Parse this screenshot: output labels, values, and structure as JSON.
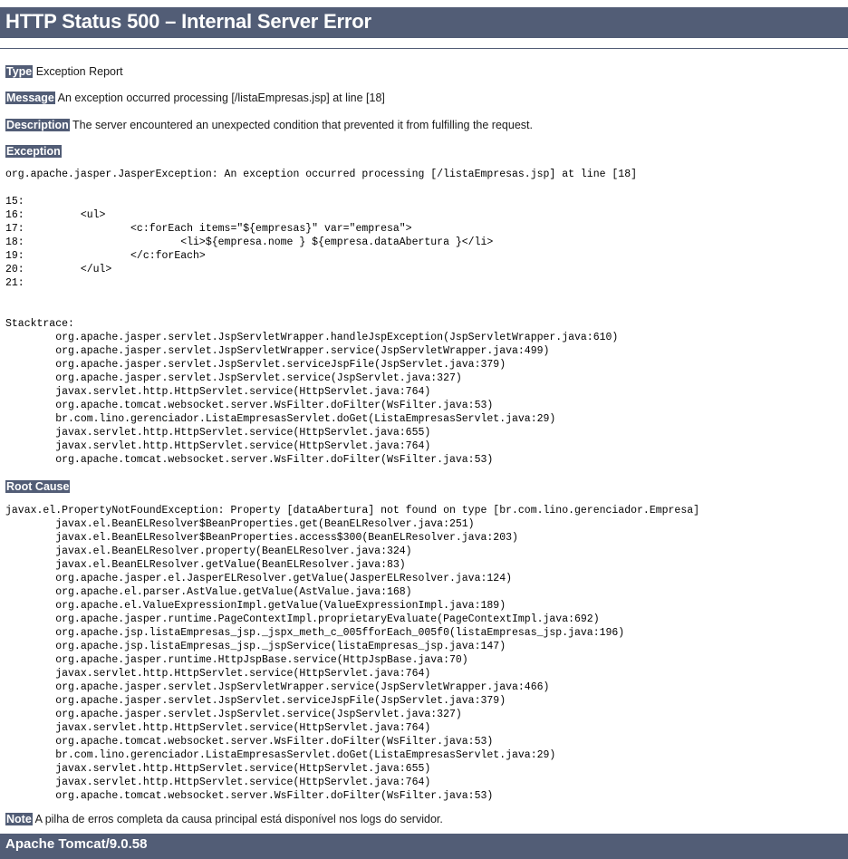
{
  "header": {
    "title": "HTTP Status 500 – Internal Server Error",
    "bar_color": "#525D76",
    "text_color": "#FFFFFF"
  },
  "details": {
    "type_label": "Type",
    "type_value": "Exception Report",
    "message_label": "Message",
    "message_value": "An exception occurred processing [/listaEmpresas.jsp] at line [18]",
    "description_label": "Description",
    "description_value": "The server encountered an unexpected condition that prevented it from fulfilling the request."
  },
  "exception_section": {
    "heading": "Exception",
    "body": "org.apache.jasper.JasperException: An exception occurred processing [/listaEmpresas.jsp] at line [18]\n\n15: \n16:         <ul>\n17:                 <c:forEach items=\"${empresas}\" var=\"empresa\">\n18:                         <li>${empresa.nome } ${empresa.dataAbertura }</li>\n19:                 </c:forEach>\n20:         </ul>\n21: \n\n\nStacktrace:\n        org.apache.jasper.servlet.JspServletWrapper.handleJspException(JspServletWrapper.java:610)\n        org.apache.jasper.servlet.JspServletWrapper.service(JspServletWrapper.java:499)\n        org.apache.jasper.servlet.JspServlet.serviceJspFile(JspServlet.java:379)\n        org.apache.jasper.servlet.JspServlet.service(JspServlet.java:327)\n        javax.servlet.http.HttpServlet.service(HttpServlet.java:764)\n        org.apache.tomcat.websocket.server.WsFilter.doFilter(WsFilter.java:53)\n        br.com.lino.gerenciador.ListaEmpresasServlet.doGet(ListaEmpresasServlet.java:29)\n        javax.servlet.http.HttpServlet.service(HttpServlet.java:655)\n        javax.servlet.http.HttpServlet.service(HttpServlet.java:764)\n        org.apache.tomcat.websocket.server.WsFilter.doFilter(WsFilter.java:53)"
  },
  "root_cause_section": {
    "heading": "Root Cause",
    "body": "javax.el.PropertyNotFoundException: Property [dataAbertura] not found on type [br.com.lino.gerenciador.Empresa]\n        javax.el.BeanELResolver$BeanProperties.get(BeanELResolver.java:251)\n        javax.el.BeanELResolver$BeanProperties.access$300(BeanELResolver.java:203)\n        javax.el.BeanELResolver.property(BeanELResolver.java:324)\n        javax.el.BeanELResolver.getValue(BeanELResolver.java:83)\n        org.apache.jasper.el.JasperELResolver.getValue(JasperELResolver.java:124)\n        org.apache.el.parser.AstValue.getValue(AstValue.java:168)\n        org.apache.el.ValueExpressionImpl.getValue(ValueExpressionImpl.java:189)\n        org.apache.jasper.runtime.PageContextImpl.proprietaryEvaluate(PageContextImpl.java:692)\n        org.apache.jsp.listaEmpresas_jsp._jspx_meth_c_005fforEach_005f0(listaEmpresas_jsp.java:196)\n        org.apache.jsp.listaEmpresas_jsp._jspService(listaEmpresas_jsp.java:147)\n        org.apache.jasper.runtime.HttpJspBase.service(HttpJspBase.java:70)\n        javax.servlet.http.HttpServlet.service(HttpServlet.java:764)\n        org.apache.jasper.servlet.JspServletWrapper.service(JspServletWrapper.java:466)\n        org.apache.jasper.servlet.JspServlet.serviceJspFile(JspServlet.java:379)\n        org.apache.jasper.servlet.JspServlet.service(JspServlet.java:327)\n        javax.servlet.http.HttpServlet.service(HttpServlet.java:764)\n        org.apache.tomcat.websocket.server.WsFilter.doFilter(WsFilter.java:53)\n        br.com.lino.gerenciador.ListaEmpresasServlet.doGet(ListaEmpresasServlet.java:29)\n        javax.servlet.http.HttpServlet.service(HttpServlet.java:655)\n        javax.servlet.http.HttpServlet.service(HttpServlet.java:764)\n        org.apache.tomcat.websocket.server.WsFilter.doFilter(WsFilter.java:53)"
  },
  "note": {
    "label": "Note",
    "text": "A pilha de erros completa da causa principal está disponível nos logs do servidor."
  },
  "footer": {
    "server": "Apache Tomcat/9.0.58"
  }
}
